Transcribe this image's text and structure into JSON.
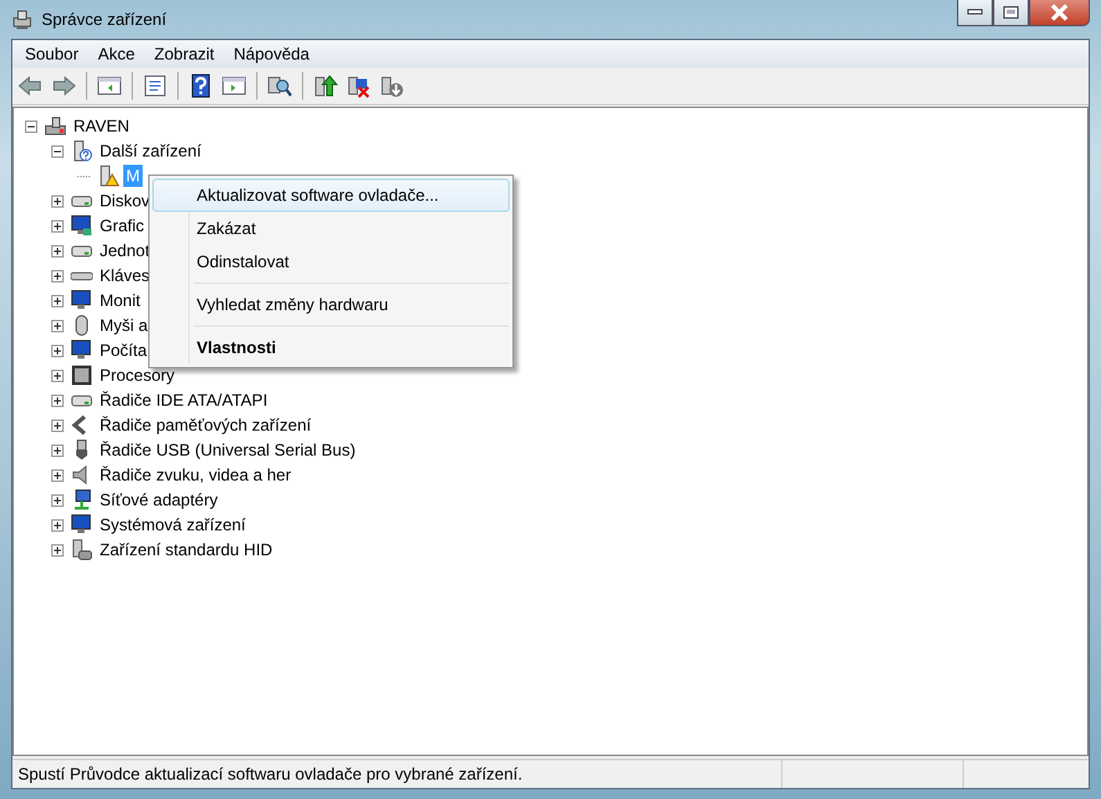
{
  "window": {
    "title": "Správce zařízení"
  },
  "menu_bar": [
    "Soubor",
    "Akce",
    "Zobrazit",
    "Nápověda"
  ],
  "toolbar": [
    {
      "kind": "back",
      "disabled": false
    },
    {
      "kind": "forward",
      "disabled": false
    },
    {
      "kind": "separator"
    },
    {
      "kind": "tree-pane",
      "disabled": false
    },
    {
      "kind": "separator"
    },
    {
      "kind": "properties",
      "disabled": false
    },
    {
      "kind": "separator"
    },
    {
      "kind": "help",
      "disabled": false
    },
    {
      "kind": "action-pane",
      "disabled": false
    },
    {
      "kind": "separator"
    },
    {
      "kind": "scan",
      "disabled": false
    },
    {
      "kind": "separator"
    },
    {
      "kind": "update",
      "disabled": false
    },
    {
      "kind": "uninstall",
      "disabled": false
    },
    {
      "kind": "disable",
      "disabled": false
    }
  ],
  "tree": [
    {
      "label": "RAVEN",
      "kind": "computer",
      "expanded": true,
      "selected": false,
      "children": [
        {
          "label": "Další zařízení",
          "kind": "unknown",
          "expanded": true,
          "selected": false,
          "children": [
            {
              "label": "M",
              "kind": "warning",
              "selected": true
            }
          ]
        },
        {
          "label": "Diskov",
          "kind": "disk",
          "expanded": false,
          "selected": false
        },
        {
          "label": "Grafic",
          "kind": "display",
          "expanded": false,
          "selected": false
        },
        {
          "label": "Jednot",
          "kind": "drive",
          "expanded": false,
          "selected": false
        },
        {
          "label": "Kláves",
          "kind": "keyboard",
          "expanded": false,
          "selected": false
        },
        {
          "label": "Monit",
          "kind": "monitor",
          "expanded": false,
          "selected": false
        },
        {
          "label": "Myši a",
          "kind": "mouse",
          "expanded": false,
          "selected": false
        },
        {
          "label": "Počíta",
          "kind": "monitor",
          "expanded": false,
          "selected": false
        },
        {
          "label": "Procesory",
          "kind": "cpu",
          "expanded": false,
          "selected": false
        },
        {
          "label": "Řadiče IDE ATA/ATAPI",
          "kind": "disk",
          "expanded": false,
          "selected": false
        },
        {
          "label": "Řadiče paměťových zařízení",
          "kind": "memory",
          "expanded": false,
          "selected": false
        },
        {
          "label": "Řadiče USB (Universal Serial Bus)",
          "kind": "usb",
          "expanded": false,
          "selected": false
        },
        {
          "label": "Řadiče zvuku, videa a her",
          "kind": "sound",
          "expanded": false,
          "selected": false
        },
        {
          "label": "Síťové adaptéry",
          "kind": "network",
          "expanded": false,
          "selected": false
        },
        {
          "label": "Systémová zařízení",
          "kind": "monitor",
          "expanded": false,
          "selected": false
        },
        {
          "label": "Zařízení standardu HID",
          "kind": "hid",
          "expanded": false,
          "selected": false
        }
      ]
    }
  ],
  "context_menu": [
    {
      "kind": "item",
      "label": "Aktualizovat software ovladače...",
      "selected": true,
      "default": false
    },
    {
      "kind": "item",
      "label": "Zakázat",
      "selected": false,
      "default": false
    },
    {
      "kind": "item",
      "label": "Odinstalovat",
      "selected": false,
      "default": false
    },
    {
      "kind": "separator"
    },
    {
      "kind": "item",
      "label": "Vyhledat změny hardwaru",
      "selected": false,
      "default": false
    },
    {
      "kind": "separator"
    },
    {
      "kind": "item",
      "label": "Vlastnosti",
      "selected": false,
      "default": true
    }
  ],
  "status_bar": {
    "text": "Spustí Průvodce aktualizací softwaru ovladače pro vybrané zařízení."
  }
}
